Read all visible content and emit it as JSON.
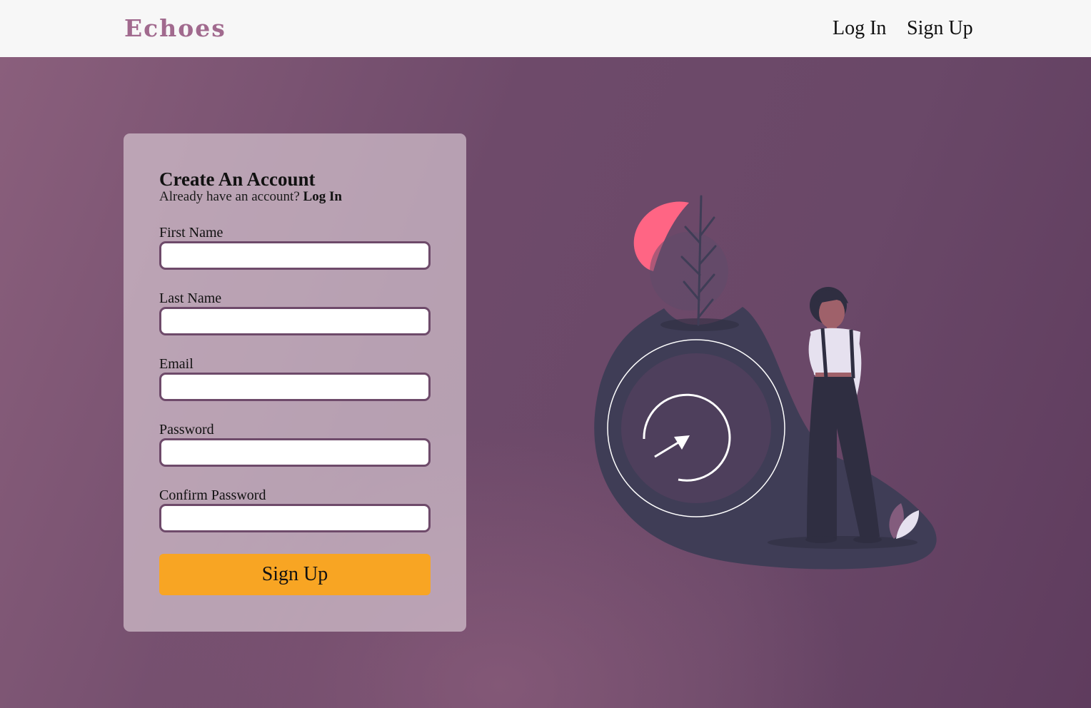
{
  "navbar": {
    "brand": "Echoes",
    "links": {
      "login": "Log In",
      "signup": "Sign Up"
    }
  },
  "form": {
    "title": "Create An Account",
    "subtitle": "Already have an account?",
    "subtitle_link": "Log In",
    "fields": [
      {
        "label": "First Name",
        "value": ""
      },
      {
        "label": "Last Name",
        "value": ""
      },
      {
        "label": "Email",
        "value": ""
      },
      {
        "label": "Password",
        "value": ""
      },
      {
        "label": "Confirm Password",
        "value": ""
      }
    ],
    "submit_label": "Sign Up"
  },
  "colors": {
    "brand": "#a16a8e",
    "background": "#6e4a6a",
    "button": "#f8a523",
    "input_border": "#6e4a6a"
  }
}
